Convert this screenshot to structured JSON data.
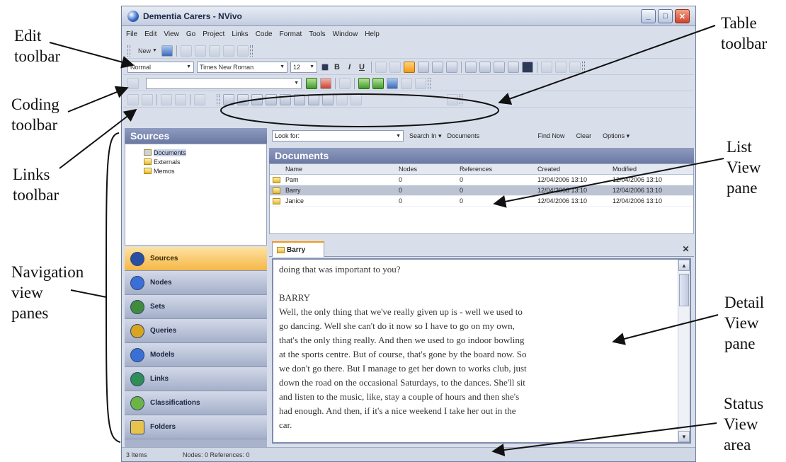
{
  "callouts": {
    "edit_toolbar": "Edit\ntoolbar",
    "coding_toolbar": "Coding\ntoolbar",
    "links_toolbar": "Links\ntoolbar",
    "navigation_view_panes": "Navigation\nview\npanes",
    "table_toolbar": "Table\ntoolbar",
    "list_view_pane": "List\nView\npane",
    "detail_view_pane": "Detail\nView\npane",
    "status_view_area": "Status\nView\narea"
  },
  "window": {
    "title": "Dementia Carers - NVivo",
    "controls": {
      "minimize": "_",
      "maximize": "□",
      "close": "✕"
    }
  },
  "menu": [
    "File",
    "Edit",
    "View",
    "Go",
    "Project",
    "Links",
    "Code",
    "Format",
    "Tools",
    "Window",
    "Help"
  ],
  "toolbar": {
    "new_label": "New",
    "style_value": "Normal",
    "font_value": "Times New Roman",
    "size_value": "12",
    "bold": "B",
    "italic": "I",
    "underline": "U"
  },
  "find": {
    "look_for_label": "Look for:",
    "search_in_label": "Search In ▾",
    "search_in_value": "Documents",
    "find_now": "Find Now",
    "clear": "Clear",
    "options": "Options ▾"
  },
  "navigation": {
    "header": "Sources",
    "tree": [
      "Documents",
      "Externals",
      "Memos"
    ],
    "buttons": [
      {
        "label": "Sources",
        "color": "#2a4ea3"
      },
      {
        "label": "Nodes",
        "color": "#3a6fd8"
      },
      {
        "label": "Sets",
        "color": "#3f8d3a"
      },
      {
        "label": "Queries",
        "color": "#d9a420"
      },
      {
        "label": "Models",
        "color": "#3a6fd8"
      },
      {
        "label": "Links",
        "color": "#2f8d55"
      },
      {
        "label": "Classifications",
        "color": "#6cb545"
      },
      {
        "label": "Folders",
        "color": "#e8c24a"
      }
    ],
    "more": "⇣"
  },
  "list": {
    "title": "Documents",
    "columns": [
      "Name",
      "Nodes",
      "References",
      "Created",
      "Modified"
    ],
    "rows": [
      {
        "name": "Pam",
        "nodes": "0",
        "references": "0",
        "created": "12/04/2006 13:10",
        "modified": "12/04/2006 13:10"
      },
      {
        "name": "Barry",
        "nodes": "0",
        "references": "0",
        "created": "12/04/2006 13:10",
        "modified": "12/04/2006 13:10"
      },
      {
        "name": "Janice",
        "nodes": "0",
        "references": "0",
        "created": "12/04/2006 13:10",
        "modified": "12/04/2006 13:10"
      }
    ]
  },
  "detail": {
    "tab_label": "Barry",
    "close": "✕",
    "text": "doing that was important to you?\n\nBARRY\nWell, the only thing that we've really given up is - well we used to\ngo dancing. Well she can't do it now so I have to go on my own,\nthat's the only thing really. And then we used to go indoor bowling\nat the sports centre. But of course, that's gone by the board now. So\nwe don't go there. But I manage to get her down to works club, just\ndown the road on the occasional Saturdays, to the dances. She'll sit\nand listen to the music, like, stay a couple of hours and then she's\nhad enough. And then, if it's a nice weekend I take her out in the\ncar."
  },
  "status": {
    "items_count": "3 Items",
    "nodes_refs": "Nodes: 0  References: 0"
  }
}
